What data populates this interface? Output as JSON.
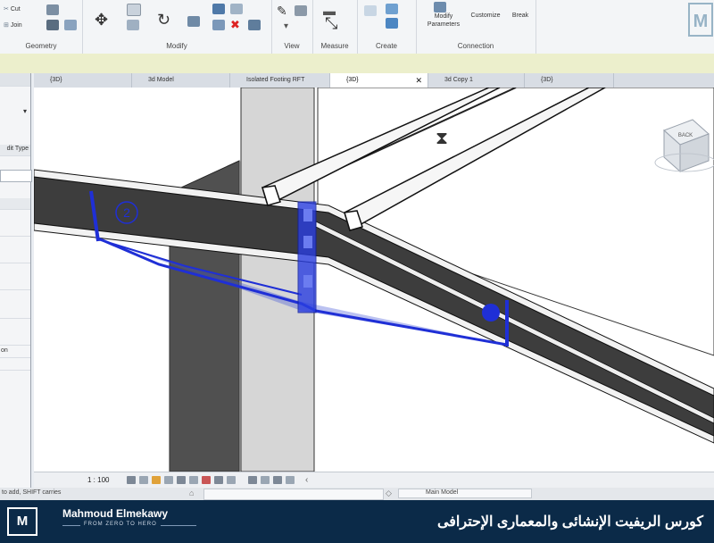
{
  "ribbon": {
    "geometry": {
      "label": "Geometry",
      "items": [
        "Cut",
        "Join"
      ]
    },
    "modify": {
      "label": "Modify"
    },
    "view": {
      "label": "View"
    },
    "measure": {
      "label": "Measure"
    },
    "create": {
      "label": "Create"
    },
    "connection": {
      "label": "Connection",
      "modify_params": "Modify\nParameters",
      "customize": "Customize",
      "break": "Break"
    }
  },
  "tabs": [
    {
      "label": "{3D}",
      "active": false
    },
    {
      "label": "3d Model",
      "active": false
    },
    {
      "label": "Isolated Footing RFT",
      "active": false
    },
    {
      "label": "{3D}",
      "active": true
    },
    {
      "label": "3d Copy 1",
      "active": false
    },
    {
      "label": "{3D}",
      "active": false
    }
  ],
  "properties": {
    "edit_type": "dit Type",
    "row_labels": [
      "on"
    ]
  },
  "viewport": {
    "tag_number": "2",
    "viewcube_label": "BACK"
  },
  "status": {
    "scale": "1 : 100",
    "hint": "to add, SHIFT carries",
    "model": "Main Model"
  },
  "banner": {
    "logo": "M",
    "brand": "Mahmoud Elmekawy",
    "tagline": "FROM ZERO TO HERO",
    "course": "كورس الريفيت الإنشائى والمعمارى الإحترافى"
  },
  "colors": {
    "accent": "#1f2fd6",
    "banner": "#0b2a48",
    "beam": "#3d3d3d",
    "column": "#d4d4d4"
  }
}
